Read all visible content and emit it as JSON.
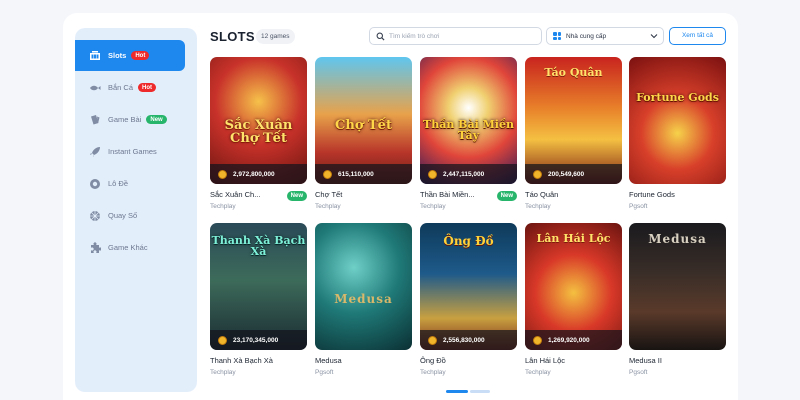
{
  "sidebar": {
    "items": [
      {
        "label": "Slots",
        "icon": "slots-icon",
        "badge": "Hot",
        "active": true
      },
      {
        "label": "Bắn Cá",
        "icon": "fish-icon",
        "badge": "Hot",
        "active": false
      },
      {
        "label": "Game Bài",
        "icon": "cards-icon",
        "badge": "New",
        "active": false
      },
      {
        "label": "Instant Games",
        "icon": "rocket-icon",
        "badge": "",
        "active": false
      },
      {
        "label": "Lô Đề",
        "icon": "lottery-ball-icon",
        "badge": "",
        "active": false
      },
      {
        "label": "Quay Số",
        "icon": "spin-wheel-icon",
        "badge": "",
        "active": false
      },
      {
        "label": "Game Khác",
        "icon": "puzzle-icon",
        "badge": "",
        "active": false
      }
    ]
  },
  "header": {
    "title": "SLOTS",
    "count": "12 games",
    "search_placeholder": "Tìm kiếm trò chơi",
    "provider_label": "Nhà cung cấp",
    "view_all": "Xem tất cả"
  },
  "games": [
    {
      "name": "Sắc Xuân Ch...",
      "provider": "Techplay",
      "jackpot": "2,972,800,000",
      "badge": "New",
      "art_title": "Sắc Xuân Chợ Tết"
    },
    {
      "name": "Chợ Tết",
      "provider": "Techplay",
      "jackpot": "615,110,000",
      "badge": "",
      "art_title": "Chợ Tết"
    },
    {
      "name": "Thần Bài Miền...",
      "provider": "Techplay",
      "jackpot": "2,447,115,000",
      "badge": "New",
      "art_title": "Thần Bài Miền Tây"
    },
    {
      "name": "Táo Quân",
      "provider": "Techplay",
      "jackpot": "200,549,600",
      "badge": "",
      "art_title": "Táo Quân"
    },
    {
      "name": "Fortune Gods",
      "provider": "Pgsoft",
      "jackpot": "",
      "badge": "",
      "art_title": "Fortune Gods"
    },
    {
      "name": "Thanh Xà Bạch Xà",
      "provider": "Techplay",
      "jackpot": "23,170,345,000",
      "badge": "",
      "art_title": "Thanh Xà Bạch Xà"
    },
    {
      "name": "Medusa",
      "provider": "Pgsoft",
      "jackpot": "",
      "badge": "",
      "art_title": "Medusa"
    },
    {
      "name": "Ông Đồ",
      "provider": "Techplay",
      "jackpot": "2,556,830,000",
      "badge": "",
      "art_title": "Ông Đồ"
    },
    {
      "name": "Lân Hái Lộc",
      "provider": "Techplay",
      "jackpot": "1,269,920,000",
      "badge": "",
      "art_title": "Lân Hái Lộc"
    },
    {
      "name": "Medusa II",
      "provider": "Pgsoft",
      "jackpot": "",
      "badge": "",
      "art_title": "Medusa"
    }
  ],
  "colors": {
    "accent": "#1e88ef",
    "hot": "#ee2a2a",
    "new": "#27b56b",
    "sidebar_bg": "#e3eefb"
  }
}
